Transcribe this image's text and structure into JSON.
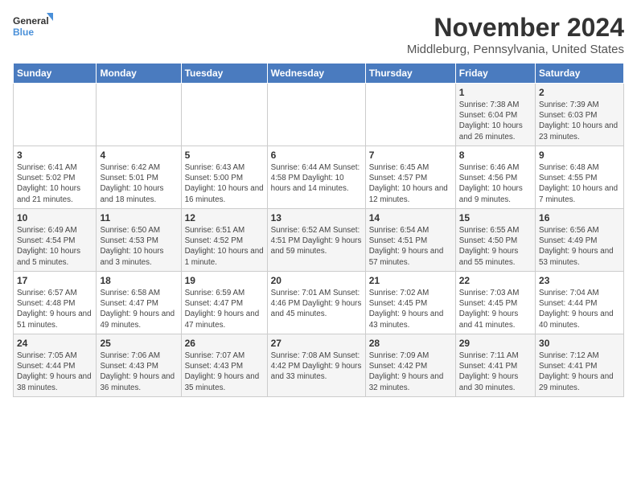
{
  "logo": {
    "line1": "General",
    "line2": "Blue"
  },
  "title": "November 2024",
  "subtitle": "Middleburg, Pennsylvania, United States",
  "days_of_week": [
    "Sunday",
    "Monday",
    "Tuesday",
    "Wednesday",
    "Thursday",
    "Friday",
    "Saturday"
  ],
  "weeks": [
    [
      {
        "day": "",
        "info": ""
      },
      {
        "day": "",
        "info": ""
      },
      {
        "day": "",
        "info": ""
      },
      {
        "day": "",
        "info": ""
      },
      {
        "day": "",
        "info": ""
      },
      {
        "day": "1",
        "info": "Sunrise: 7:38 AM\nSunset: 6:04 PM\nDaylight: 10 hours and 26 minutes."
      },
      {
        "day": "2",
        "info": "Sunrise: 7:39 AM\nSunset: 6:03 PM\nDaylight: 10 hours and 23 minutes."
      }
    ],
    [
      {
        "day": "3",
        "info": "Sunrise: 6:41 AM\nSunset: 5:02 PM\nDaylight: 10 hours and 21 minutes."
      },
      {
        "day": "4",
        "info": "Sunrise: 6:42 AM\nSunset: 5:01 PM\nDaylight: 10 hours and 18 minutes."
      },
      {
        "day": "5",
        "info": "Sunrise: 6:43 AM\nSunset: 5:00 PM\nDaylight: 10 hours and 16 minutes."
      },
      {
        "day": "6",
        "info": "Sunrise: 6:44 AM\nSunset: 4:58 PM\nDaylight: 10 hours and 14 minutes."
      },
      {
        "day": "7",
        "info": "Sunrise: 6:45 AM\nSunset: 4:57 PM\nDaylight: 10 hours and 12 minutes."
      },
      {
        "day": "8",
        "info": "Sunrise: 6:46 AM\nSunset: 4:56 PM\nDaylight: 10 hours and 9 minutes."
      },
      {
        "day": "9",
        "info": "Sunrise: 6:48 AM\nSunset: 4:55 PM\nDaylight: 10 hours and 7 minutes."
      }
    ],
    [
      {
        "day": "10",
        "info": "Sunrise: 6:49 AM\nSunset: 4:54 PM\nDaylight: 10 hours and 5 minutes."
      },
      {
        "day": "11",
        "info": "Sunrise: 6:50 AM\nSunset: 4:53 PM\nDaylight: 10 hours and 3 minutes."
      },
      {
        "day": "12",
        "info": "Sunrise: 6:51 AM\nSunset: 4:52 PM\nDaylight: 10 hours and 1 minute."
      },
      {
        "day": "13",
        "info": "Sunrise: 6:52 AM\nSunset: 4:51 PM\nDaylight: 9 hours and 59 minutes."
      },
      {
        "day": "14",
        "info": "Sunrise: 6:54 AM\nSunset: 4:51 PM\nDaylight: 9 hours and 57 minutes."
      },
      {
        "day": "15",
        "info": "Sunrise: 6:55 AM\nSunset: 4:50 PM\nDaylight: 9 hours and 55 minutes."
      },
      {
        "day": "16",
        "info": "Sunrise: 6:56 AM\nSunset: 4:49 PM\nDaylight: 9 hours and 53 minutes."
      }
    ],
    [
      {
        "day": "17",
        "info": "Sunrise: 6:57 AM\nSunset: 4:48 PM\nDaylight: 9 hours and 51 minutes."
      },
      {
        "day": "18",
        "info": "Sunrise: 6:58 AM\nSunset: 4:47 PM\nDaylight: 9 hours and 49 minutes."
      },
      {
        "day": "19",
        "info": "Sunrise: 6:59 AM\nSunset: 4:47 PM\nDaylight: 9 hours and 47 minutes."
      },
      {
        "day": "20",
        "info": "Sunrise: 7:01 AM\nSunset: 4:46 PM\nDaylight: 9 hours and 45 minutes."
      },
      {
        "day": "21",
        "info": "Sunrise: 7:02 AM\nSunset: 4:45 PM\nDaylight: 9 hours and 43 minutes."
      },
      {
        "day": "22",
        "info": "Sunrise: 7:03 AM\nSunset: 4:45 PM\nDaylight: 9 hours and 41 minutes."
      },
      {
        "day": "23",
        "info": "Sunrise: 7:04 AM\nSunset: 4:44 PM\nDaylight: 9 hours and 40 minutes."
      }
    ],
    [
      {
        "day": "24",
        "info": "Sunrise: 7:05 AM\nSunset: 4:44 PM\nDaylight: 9 hours and 38 minutes."
      },
      {
        "day": "25",
        "info": "Sunrise: 7:06 AM\nSunset: 4:43 PM\nDaylight: 9 hours and 36 minutes."
      },
      {
        "day": "26",
        "info": "Sunrise: 7:07 AM\nSunset: 4:43 PM\nDaylight: 9 hours and 35 minutes."
      },
      {
        "day": "27",
        "info": "Sunrise: 7:08 AM\nSunset: 4:42 PM\nDaylight: 9 hours and 33 minutes."
      },
      {
        "day": "28",
        "info": "Sunrise: 7:09 AM\nSunset: 4:42 PM\nDaylight: 9 hours and 32 minutes."
      },
      {
        "day": "29",
        "info": "Sunrise: 7:11 AM\nSunset: 4:41 PM\nDaylight: 9 hours and 30 minutes."
      },
      {
        "day": "30",
        "info": "Sunrise: 7:12 AM\nSunset: 4:41 PM\nDaylight: 9 hours and 29 minutes."
      }
    ]
  ]
}
